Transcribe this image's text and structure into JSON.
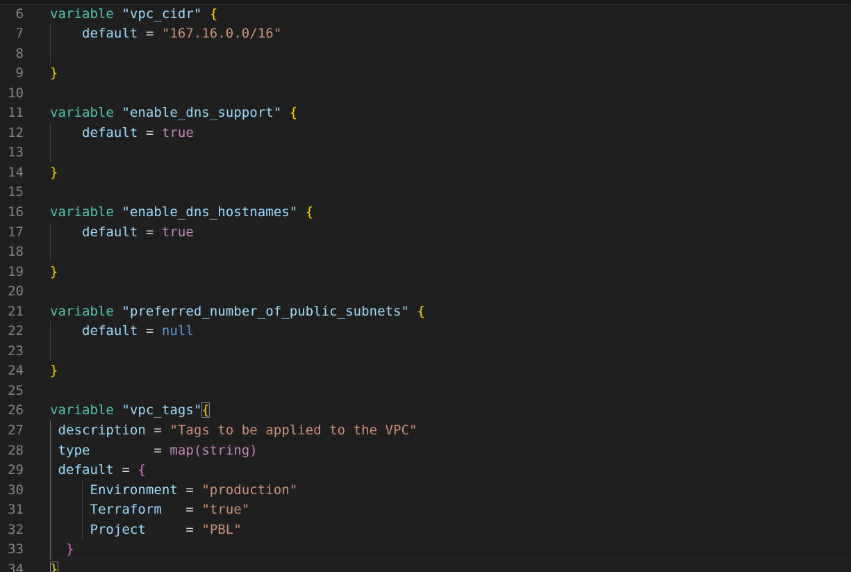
{
  "editor": {
    "language": "terraform",
    "lines": [
      {
        "n": "6",
        "tokens": [
          {
            "t": "kw",
            "v": "variable"
          },
          {
            "t": "op",
            "v": " "
          },
          {
            "t": "id",
            "v": "\"vpc_cidr\""
          },
          {
            "t": "op",
            "v": " "
          },
          {
            "t": "b1",
            "v": "{"
          }
        ]
      },
      {
        "n": "7",
        "tokens": [
          {
            "t": "op",
            "v": "    "
          },
          {
            "t": "id",
            "v": "default"
          },
          {
            "t": "op",
            "v": " = "
          },
          {
            "t": "str",
            "v": "\"167.16.0.0/16\""
          }
        ]
      },
      {
        "n": "8",
        "tokens": []
      },
      {
        "n": "9",
        "tokens": [
          {
            "t": "b1",
            "v": "}"
          }
        ]
      },
      {
        "n": "10",
        "tokens": []
      },
      {
        "n": "11",
        "tokens": [
          {
            "t": "kw",
            "v": "variable"
          },
          {
            "t": "op",
            "v": " "
          },
          {
            "t": "id",
            "v": "\"enable_dns_support\""
          },
          {
            "t": "op",
            "v": " "
          },
          {
            "t": "b1",
            "v": "{"
          }
        ]
      },
      {
        "n": "12",
        "tokens": [
          {
            "t": "op",
            "v": "    "
          },
          {
            "t": "id",
            "v": "default"
          },
          {
            "t": "op",
            "v": " = "
          },
          {
            "t": "lit",
            "v": "true"
          }
        ]
      },
      {
        "n": "13",
        "tokens": []
      },
      {
        "n": "14",
        "tokens": [
          {
            "t": "b1",
            "v": "}"
          }
        ]
      },
      {
        "n": "15",
        "tokens": []
      },
      {
        "n": "16",
        "tokens": [
          {
            "t": "kw",
            "v": "variable"
          },
          {
            "t": "op",
            "v": " "
          },
          {
            "t": "id",
            "v": "\"enable_dns_hostnames\""
          },
          {
            "t": "op",
            "v": " "
          },
          {
            "t": "b1",
            "v": "{"
          }
        ]
      },
      {
        "n": "17",
        "tokens": [
          {
            "t": "op",
            "v": "    "
          },
          {
            "t": "id",
            "v": "default"
          },
          {
            "t": "op",
            "v": " = "
          },
          {
            "t": "lit",
            "v": "true"
          }
        ]
      },
      {
        "n": "18",
        "tokens": []
      },
      {
        "n": "19",
        "tokens": [
          {
            "t": "b1",
            "v": "}"
          }
        ]
      },
      {
        "n": "20",
        "tokens": []
      },
      {
        "n": "21",
        "tokens": [
          {
            "t": "kw",
            "v": "variable"
          },
          {
            "t": "op",
            "v": " "
          },
          {
            "t": "id",
            "v": "\"preferred_number_of_public_subnets\""
          },
          {
            "t": "op",
            "v": " "
          },
          {
            "t": "b1",
            "v": "{"
          }
        ]
      },
      {
        "n": "22",
        "tokens": [
          {
            "t": "op",
            "v": "    "
          },
          {
            "t": "id",
            "v": "default"
          },
          {
            "t": "op",
            "v": " = "
          },
          {
            "t": "nul",
            "v": "null"
          }
        ]
      },
      {
        "n": "23",
        "tokens": []
      },
      {
        "n": "24",
        "tokens": [
          {
            "t": "b1",
            "v": "}"
          }
        ]
      },
      {
        "n": "25",
        "tokens": []
      },
      {
        "n": "26",
        "tokens": [
          {
            "t": "kw",
            "v": "variable"
          },
          {
            "t": "op",
            "v": " "
          },
          {
            "t": "id",
            "v": "\"vpc_tags\""
          },
          {
            "t": "b1 bm",
            "v": "{"
          }
        ]
      },
      {
        "n": "27",
        "tokens": [
          {
            "t": "op",
            "v": " "
          },
          {
            "t": "id",
            "v": "description"
          },
          {
            "t": "op",
            "v": " = "
          },
          {
            "t": "str",
            "v": "\"Tags to be applied to the VPC\""
          }
        ]
      },
      {
        "n": "28",
        "tokens": [
          {
            "t": "op",
            "v": " "
          },
          {
            "t": "id",
            "v": "type"
          },
          {
            "t": "op",
            "v": "        = "
          },
          {
            "t": "lit",
            "v": "map(string)"
          }
        ]
      },
      {
        "n": "29",
        "tokens": [
          {
            "t": "op",
            "v": " "
          },
          {
            "t": "id",
            "v": "default"
          },
          {
            "t": "op",
            "v": " = "
          },
          {
            "t": "b2",
            "v": "{"
          }
        ]
      },
      {
        "n": "30",
        "tokens": [
          {
            "t": "op",
            "v": "     "
          },
          {
            "t": "id",
            "v": "Environment"
          },
          {
            "t": "op",
            "v": " = "
          },
          {
            "t": "str",
            "v": "\"production\""
          }
        ]
      },
      {
        "n": "31",
        "tokens": [
          {
            "t": "op",
            "v": "     "
          },
          {
            "t": "id",
            "v": "Terraform"
          },
          {
            "t": "op",
            "v": "   = "
          },
          {
            "t": "str",
            "v": "\"true\""
          }
        ]
      },
      {
        "n": "32",
        "tokens": [
          {
            "t": "op",
            "v": "     "
          },
          {
            "t": "id",
            "v": "Project"
          },
          {
            "t": "op",
            "v": "     = "
          },
          {
            "t": "str",
            "v": "\"PBL\""
          }
        ]
      },
      {
        "n": "33",
        "tokens": [
          {
            "t": "op",
            "v": "  "
          },
          {
            "t": "b2",
            "v": "}"
          }
        ]
      },
      {
        "n": "34",
        "tokens": [
          {
            "t": "b1 bm",
            "v": "}"
          }
        ],
        "current": true
      }
    ]
  },
  "colors": {
    "background": "#1f1f1f",
    "line_number": "#858585",
    "keyword": "#4ec9b0",
    "identifier": "#9cdcfe",
    "string": "#ce9178",
    "literal": "#c586c0",
    "null": "#569cd6",
    "bracket_level1": "#ffd700",
    "bracket_level2": "#da70d6"
  }
}
